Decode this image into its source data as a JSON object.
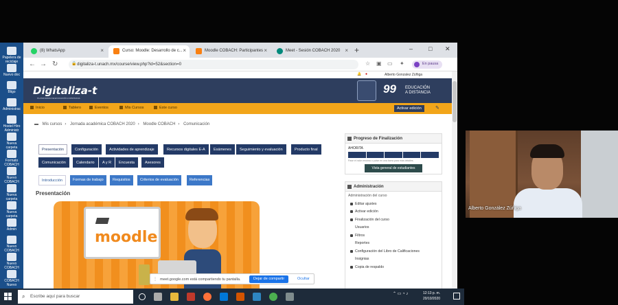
{
  "desktop": {
    "icons": [
      "Papelera de reciclaje",
      "Nuevo doc",
      "Bligo",
      "Administrac",
      "Hostel Hiro Administr",
      "Nueva carpeta",
      "Formato COBACH",
      "Nuevo COBACH",
      "Nueva carpeta",
      "Nueva carpeta",
      "Admin",
      "Nuevo COBACH",
      "Nuevo COBACH",
      "COBACH Nuevo"
    ]
  },
  "browser": {
    "tabs": [
      {
        "title": "(8) WhatsApp",
        "color": "#25d366",
        "active": false
      },
      {
        "title": "Curso: Moodle: Desarrollo de c...",
        "color": "#f98012",
        "active": true
      },
      {
        "title": "Moodle COBACH: Participantes",
        "color": "#f98012",
        "active": false
      },
      {
        "title": "Meet - Sesión COBACH 2020",
        "color": "#00897b",
        "active": false
      }
    ],
    "url": "digitaliza-t.unach.mx/course/view.php?id=52&section=0",
    "pause_label": "En pausa",
    "window_controls": [
      "–",
      "□",
      "✕"
    ]
  },
  "site": {
    "user_name": "Alberto Gonzalez Zúñiga",
    "logo": "Digitaliza-t",
    "logo_tagline": "PLATAFORMA DE EDUCACIÓN A DISTANCIA",
    "edu_text_1": "EDUCACIÓN",
    "edu_text_2": "A DISTANCIA",
    "menu": [
      "Inicio",
      "Tablero",
      "Eventos",
      "Mis Cursos",
      "Este curso"
    ],
    "edit_button": "Activar edición",
    "breadcrumb": [
      "Mis cursos",
      "Jornada académica COBACH 2020",
      "Moodle COBACH",
      "Comunicación"
    ],
    "tabs_row1": [
      "Presentación",
      "Configuración",
      "Actividades de aprendizaje",
      "Recursos digitales E-A",
      "Exámenes",
      "Seguimiento y evaluación",
      "Producto final"
    ],
    "tabs_row2": [
      "Comunicación",
      "Calendario",
      "A y R",
      "Encuesta",
      "Asesores"
    ],
    "subtabs": [
      "Introducción",
      "Formas de trabajo",
      "Requisitos",
      "Criterios de evaluación",
      "Referencias"
    ],
    "section_title": "Presentación",
    "hero_word": "moodle",
    "progress": {
      "title": "Progreso de Finalización",
      "label": "AHORITA",
      "note": "Pase el ratón encima o pulse en una barra para más detalles.",
      "button": "Vista general de estudiantes"
    },
    "admin": {
      "title": "Administración",
      "items": [
        "Administración del curso",
        "Editar ajustes",
        "Activar edición",
        "Finalización del curso",
        "Usuarios",
        "Filtros",
        "Reportes",
        "Configuración del Libro de Calificaciones",
        "Insignias",
        "Copia de respaldo"
      ]
    },
    "share_bar": {
      "text": "meet.google.com está compartiendo tu pantalla.",
      "stop": "Dejar de compartir",
      "hide": "Ocultar"
    }
  },
  "webcam": {
    "name": "Alberto González Zúñiga"
  },
  "taskbar": {
    "search_placeholder": "Escribe aquí para buscar",
    "time": "12:13 p. m.",
    "date": "20/10/2020"
  }
}
